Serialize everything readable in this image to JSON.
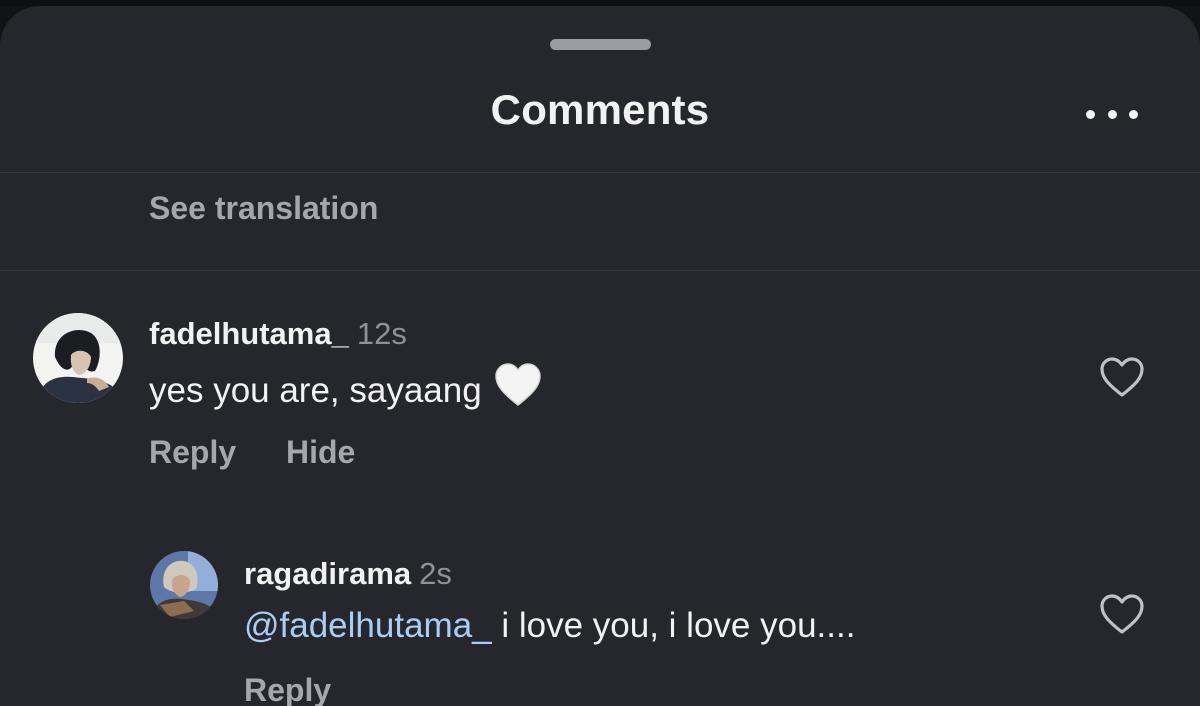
{
  "sheet": {
    "title": "Comments",
    "more_icon": "more-horizontal-icon"
  },
  "caption": {
    "see_translation": "See translation"
  },
  "comments": [
    {
      "username": "fadelhutama_",
      "time": "12s",
      "text": "yes you are, sayaang",
      "emoji": "white-heart-icon",
      "actions": [
        "Reply",
        "Hide"
      ],
      "like_icon": "heart-outline-icon"
    },
    {
      "username": "ragadirama",
      "time": "2s",
      "mention": "@fadelhutama_",
      "text": " i love you, i love you....",
      "actions": [
        "Reply"
      ],
      "like_icon": "heart-outline-icon"
    }
  ],
  "colors": {
    "background": "#25272c",
    "text_primary": "#f2f2f4",
    "text_secondary": "#a4a7ad",
    "mention": "#a9cdf4"
  }
}
